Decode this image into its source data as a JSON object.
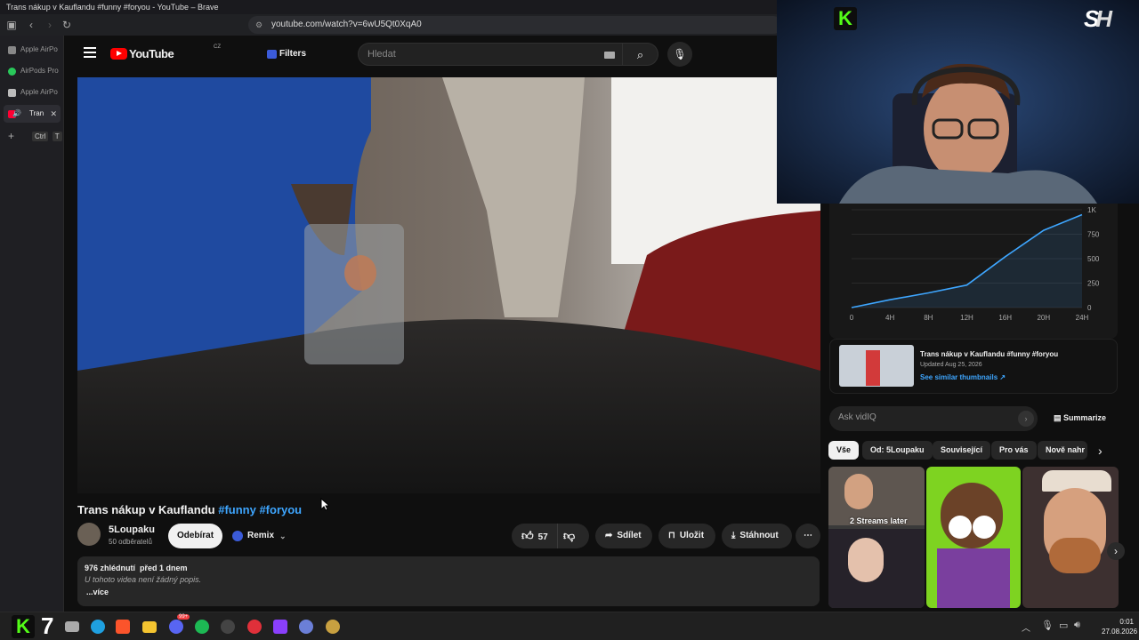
{
  "window": {
    "title": "Trans nákup v Kauflandu #funny #foryou - YouTube – Brave"
  },
  "browser": {
    "url": "youtube.com/watch?v=6wU5Qt0XqA0",
    "tabs": [
      {
        "label": "Apple AirPo",
        "color": "#888888"
      },
      {
        "label": "AirPods Pro",
        "color": "#29c85a"
      },
      {
        "label": "Apple AirPo",
        "color": "#bbbbbb"
      },
      {
        "label": "Tran",
        "color": "#ff0033"
      }
    ],
    "new_tab_shortcut": [
      "Ctrl",
      "T"
    ]
  },
  "youtube": {
    "logo": "YouTube",
    "region": "CZ",
    "filters_label": "Filters",
    "search_placeholder": "Hledat"
  },
  "video": {
    "title_main": "Trans nákup v Kauflandu",
    "hashtags": "#funny #foryou",
    "channel_name": "5Loupaku",
    "subscribers": "50 odběratelů",
    "subscribe_label": "Odebírat",
    "remix_label": "Remix",
    "likes": "57",
    "share_label": "Sdílet",
    "save_label": "Uložit",
    "download_label": "Stáhnout",
    "views_date": "976 zhlédnutí  před 1 dnem",
    "description": "U tohoto videa není žádný popis.",
    "more_label": "...více"
  },
  "chart_data": {
    "type": "line",
    "x": [
      "0",
      "4H",
      "8H",
      "12H",
      "16H",
      "20H",
      "24H"
    ],
    "series": [
      {
        "values": [
          0,
          80,
          150,
          230,
          520,
          790,
          950
        ]
      }
    ],
    "y_ticks": [
      "0",
      "250",
      "500",
      "750",
      "1K"
    ],
    "ylim": [
      0,
      1000
    ]
  },
  "similar": {
    "title": "Trans nákup v Kauflandu #funny #foryou",
    "updated": "Updated Aug 25, 2026",
    "link": "See similar thumbnails ↗"
  },
  "vidiq": {
    "ask_placeholder": "Ask vidIQ",
    "summarize_label": "Summarize"
  },
  "chips": [
    "Vše",
    "Od: 5Loupaku",
    "Související",
    "Pro vás",
    "Nově nahr"
  ],
  "thumb_caption": "2 Streams later",
  "taskbar": {
    "time": "0:01",
    "date": "27.08.2026",
    "badge": "7",
    "discord_badge": "99+"
  },
  "colors": {
    "accent": "#3ea6ff",
    "yt_red": "#ff0000",
    "kick_green": "#53fc18"
  }
}
